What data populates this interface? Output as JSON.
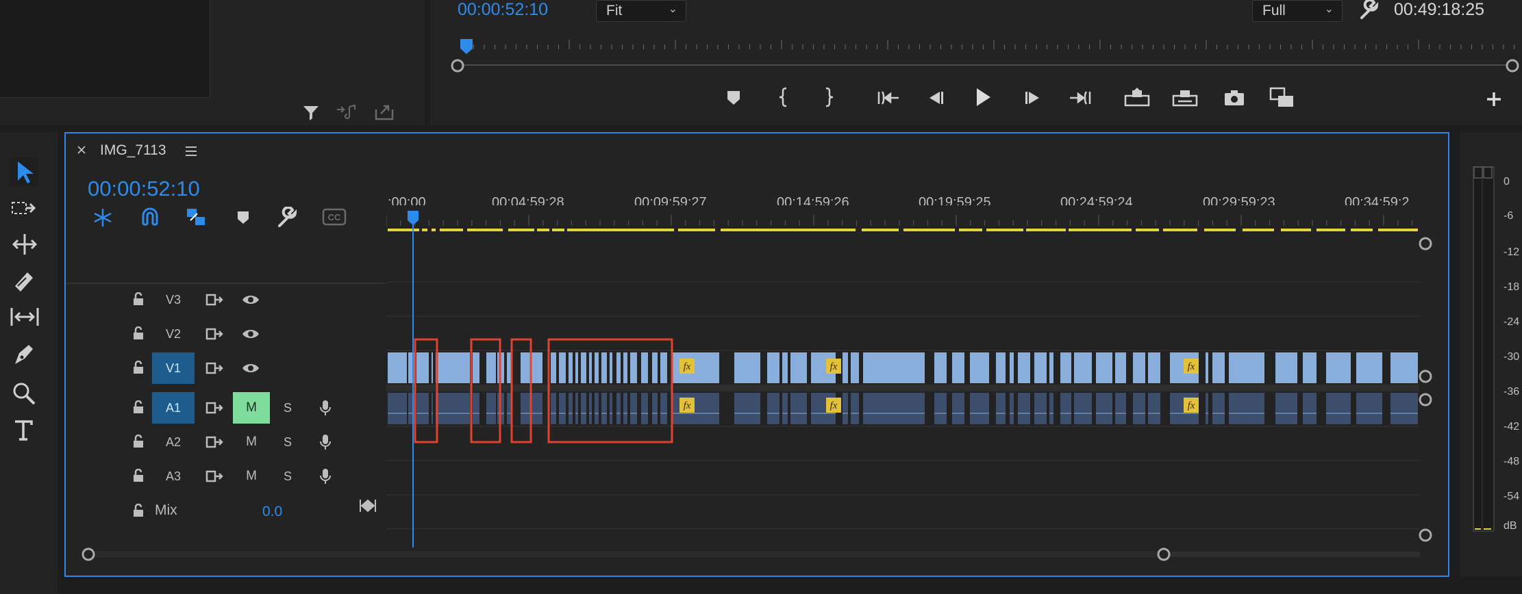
{
  "program_monitor": {
    "playhead_timecode": "00:00:52:10",
    "zoom_value": "Fit",
    "resolution_value": "Full",
    "duration": "00:49:18:25"
  },
  "sequence": {
    "tab_name": "IMG_7113",
    "timecode": "00:00:52:10",
    "ruler_labels": [
      ":00:00",
      "00:04:59:28",
      "00:09:59:27",
      "00:14:59:26",
      "00:19:59:25",
      "00:24:59:24",
      "00:29:59:23",
      "00:34:59:2"
    ]
  },
  "tracks": {
    "video": [
      {
        "label": "V3",
        "targeted": false
      },
      {
        "label": "V2",
        "targeted": false
      },
      {
        "label": "V1",
        "targeted": true
      }
    ],
    "audio": [
      {
        "label": "A1",
        "targeted": true,
        "mute": "M",
        "solo": "S",
        "muted_active": true
      },
      {
        "label": "A2",
        "targeted": false,
        "mute": "M",
        "solo": "S",
        "muted_active": false
      },
      {
        "label": "A3",
        "targeted": false,
        "mute": "M",
        "solo": "S",
        "muted_active": false
      }
    ],
    "mix": {
      "label": "Mix",
      "value": "0.0"
    }
  },
  "clip_fx_label": "fx",
  "vu_meter": {
    "scale": [
      "0",
      "-6",
      "-12",
      "-18",
      "-24",
      "-30",
      "-36",
      "-42",
      "-48",
      "-54",
      "dB"
    ]
  },
  "colors": {
    "accent_blue": "#2d8ceb",
    "video_clip": "#8aaedb",
    "audio_clip": "#3c4e6c",
    "render_bar": "#e4d53a",
    "annotation_red": "#e0432f",
    "mute_active": "#7fdc9c"
  }
}
